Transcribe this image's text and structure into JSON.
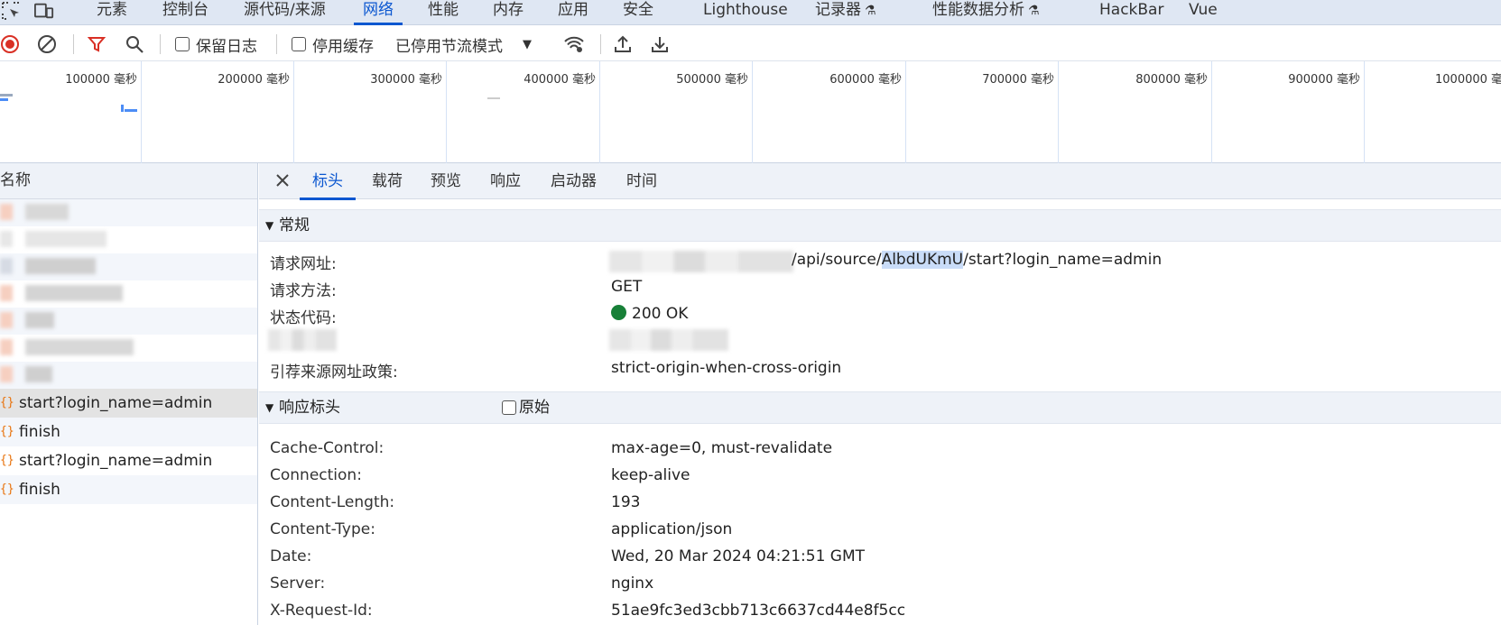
{
  "top_tabs": [
    {
      "label": "元素"
    },
    {
      "label": "控制台"
    },
    {
      "label": "源代码/来源"
    },
    {
      "label": "网络"
    },
    {
      "label": "性能"
    },
    {
      "label": "内存"
    },
    {
      "label": "应用"
    },
    {
      "label": "安全"
    },
    {
      "label": "Lighthouse"
    },
    {
      "label": "记录器"
    },
    {
      "label": "性能数据分析"
    },
    {
      "label": "HackBar"
    },
    {
      "label": "Vue"
    }
  ],
  "active_tab": "网络",
  "toolbar": {
    "preserve_log_label": "保留日志",
    "disable_cache_label": "停用缓存",
    "throttle_value": "已停用节流模式"
  },
  "overview": {
    "ticks": [
      "100000 毫秒",
      "200000 毫秒",
      "300000 毫秒",
      "400000 毫秒",
      "500000 毫秒",
      "600000 毫秒",
      "700000 毫秒",
      "800000 毫秒",
      "900000 毫秒",
      "1000000 毫秒"
    ]
  },
  "name_list": {
    "header": "名称",
    "requests": [
      {
        "name": "start?login_name=admin",
        "icon": "xhr-icon"
      },
      {
        "name": "finish",
        "icon": "xhr-icon"
      },
      {
        "name": "start?login_name=admin",
        "icon": "xhr-icon"
      },
      {
        "name": "finish",
        "icon": "xhr-icon"
      }
    ]
  },
  "details": {
    "tabs": [
      "标头",
      "载荷",
      "预览",
      "响应",
      "启动器",
      "时间"
    ],
    "active_tab": "标头",
    "general": {
      "title": "常规",
      "request_url_label": "请求网址:",
      "request_url_path_pre": "/api/source/",
      "request_url_highlight": "AlbdUKmU",
      "request_url_path_post": "/start?login_name=admin",
      "method_label": "请求方法:",
      "method_value": "GET",
      "status_label": "状态代码:",
      "status_value": "200 OK",
      "status_color": "#188038",
      "referrer_label": "引荐来源网址政策:",
      "referrer_value": "strict-origin-when-cross-origin"
    },
    "response_headers": {
      "title": "响应标头",
      "raw_label": "原始",
      "items": [
        {
          "key": "Cache-Control:",
          "value": "max-age=0, must-revalidate"
        },
        {
          "key": "Connection:",
          "value": "keep-alive"
        },
        {
          "key": "Content-Length:",
          "value": "193"
        },
        {
          "key": "Content-Type:",
          "value": "application/json"
        },
        {
          "key": "Date:",
          "value": "Wed, 20 Mar 2024 04:21:51 GMT"
        },
        {
          "key": "Server:",
          "value": "nginx"
        },
        {
          "key": "X-Request-Id:",
          "value": "51ae9fc3ed3cbb713c6637cd44e8f5cc"
        }
      ]
    }
  },
  "colors": {
    "accent": "#0b57d0",
    "record": "#d93025",
    "filter": "#d93025",
    "xhr_icon": "#e8710a"
  }
}
